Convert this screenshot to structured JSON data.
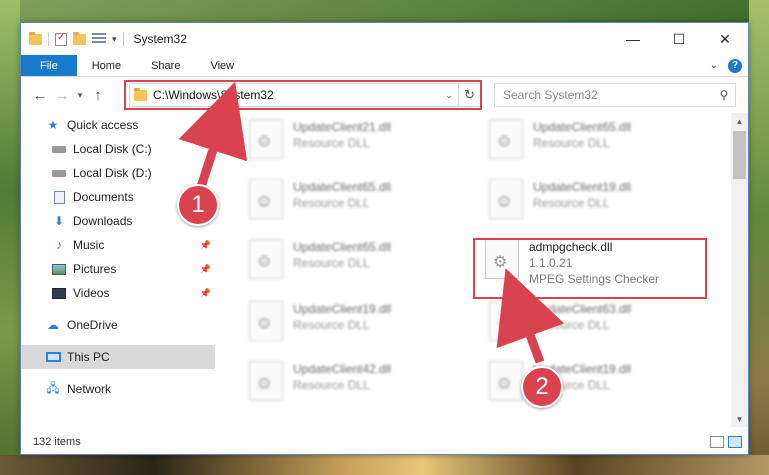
{
  "window": {
    "title": "System32"
  },
  "ribbon": {
    "tabs": [
      "File",
      "Home",
      "Share",
      "View"
    ]
  },
  "address": {
    "path": "C:\\Windows\\System32"
  },
  "search": {
    "placeholder": "Search System32"
  },
  "sidebar": {
    "items": [
      {
        "label": "Quick access",
        "icon": "star-icon"
      },
      {
        "label": "Local Disk (C:)",
        "icon": "disk-icon"
      },
      {
        "label": "Local Disk (D:)",
        "icon": "disk-icon"
      },
      {
        "label": "Documents",
        "icon": "document-icon"
      },
      {
        "label": "Downloads",
        "icon": "download-icon"
      },
      {
        "label": "Music",
        "icon": "music-icon"
      },
      {
        "label": "Pictures",
        "icon": "pictures-icon"
      },
      {
        "label": "Videos",
        "icon": "videos-icon"
      },
      {
        "label": "OneDrive",
        "icon": "cloud-icon"
      },
      {
        "label": "This PC",
        "icon": "computer-icon"
      },
      {
        "label": "Network",
        "icon": "network-icon"
      }
    ]
  },
  "files": [
    {
      "name": "UpdateClient21.dll",
      "desc": "Resource DLL"
    },
    {
      "name": "UpdateClient65.dll",
      "desc": "Resource DLL"
    },
    {
      "name": "UpdateClient65.dll",
      "desc": "Resource DLL"
    },
    {
      "name": "UpdateClient19.dll",
      "desc": "Resource DLL"
    },
    {
      "name": "UpdateClient65.dll",
      "desc": "Resource DLL"
    },
    {
      "name": "admpgcheck.dll",
      "version": "1.1.0.21",
      "desc": "MPEG Settings Checker"
    },
    {
      "name": "UpdateClient19.dll",
      "desc": "Resource DLL"
    },
    {
      "name": "UpdateClient63.dll",
      "desc": "Resource DLL"
    },
    {
      "name": "UpdateClient42.dll",
      "desc": "Resource DLL"
    },
    {
      "name": "UpdateClient19.dll",
      "desc": "Resource DLL"
    }
  ],
  "status": {
    "item_count": "132 items"
  },
  "callouts": [
    "1",
    "2"
  ],
  "colors": {
    "accent": "#1979ca",
    "highlight": "#d9434f"
  }
}
